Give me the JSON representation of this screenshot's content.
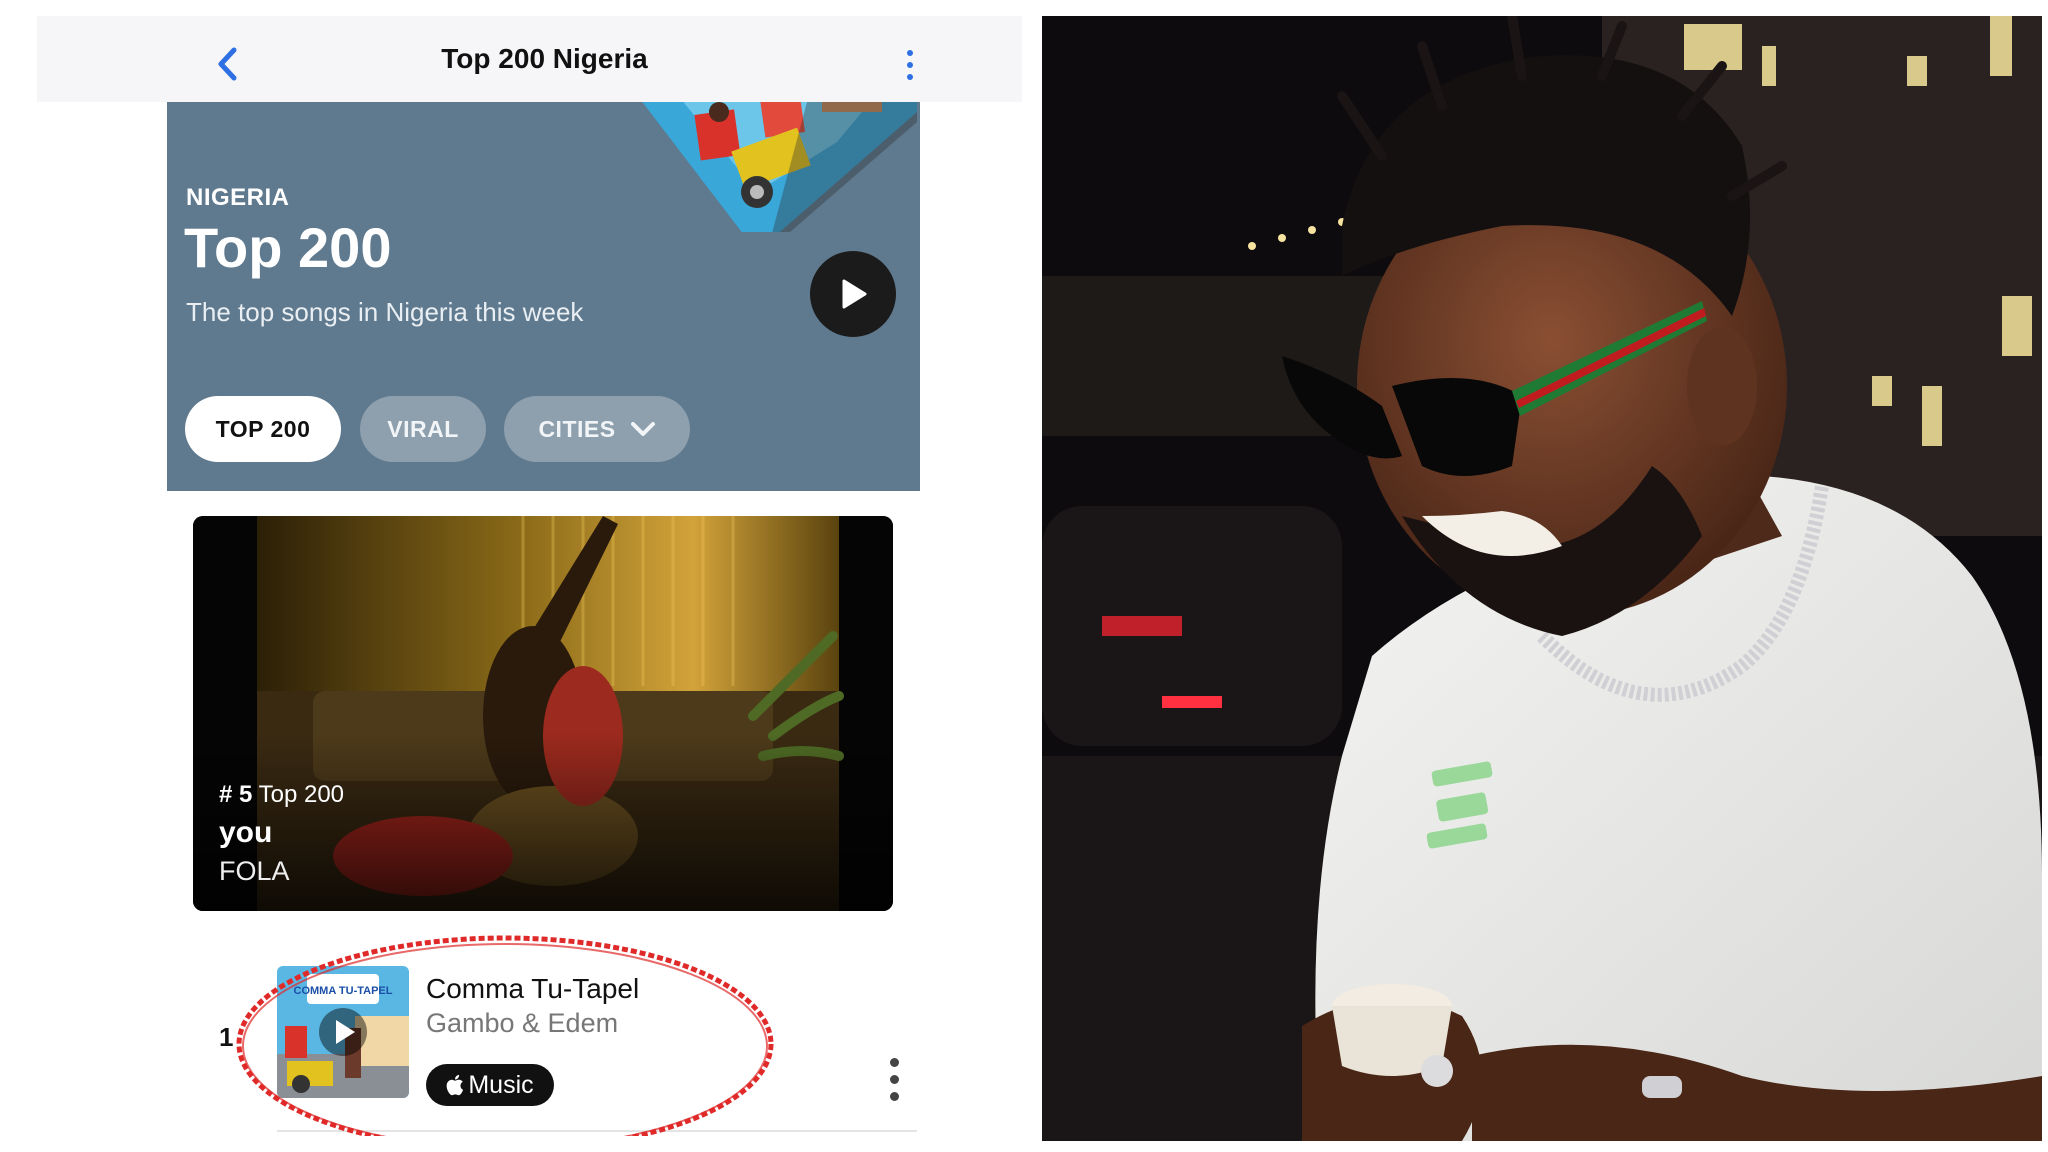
{
  "nav": {
    "title": "Top 200 Nigeria"
  },
  "hero": {
    "country": "NIGERIA",
    "title": "Top 200",
    "subtitle": "The top songs in Nigeria this week",
    "tabs": [
      {
        "label": "TOP 200",
        "active": true
      },
      {
        "label": "VIRAL",
        "active": false
      },
      {
        "label": "CITIES",
        "active": false
      }
    ]
  },
  "featured": {
    "rank_prefix": "# 5",
    "rank_chart": "Top 200",
    "song": "you",
    "artist": "FOLA"
  },
  "chart_list": [
    {
      "rank": "1",
      "title": "Comma Tu-Tapel",
      "artist": "Gambo & Edem",
      "badge": "Music",
      "art_text": "COMMA TU-TAPEL"
    }
  ],
  "colors": {
    "accent": "#2f6fe4",
    "hero_bg": "#5f7a8f",
    "pill_inactive": "#8ea0ae",
    "highlight": "#e02a2a"
  },
  "icons": [
    "chevron-left-icon",
    "more-vertical-icon",
    "play-icon",
    "chevron-down-icon",
    "apple-logo-icon"
  ]
}
